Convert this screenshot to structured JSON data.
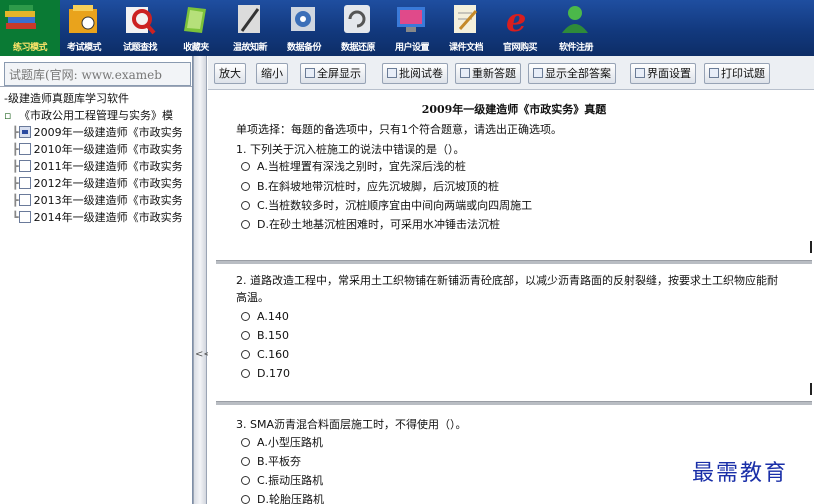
{
  "topbar": {
    "items": [
      {
        "label": "练习模式",
        "icon": "books-icon",
        "active": true
      },
      {
        "label": "考试模式",
        "icon": "exam-folder-icon"
      },
      {
        "label": "试题查找",
        "icon": "search-magnifier-icon"
      },
      {
        "label": "收藏夹",
        "icon": "favorites-icon"
      },
      {
        "label": "温故知新",
        "icon": "review-notes-icon"
      },
      {
        "label": "数据备份",
        "icon": "backup-disk-icon"
      },
      {
        "label": "数据还原",
        "icon": "restore-icon"
      },
      {
        "label": "用户设置",
        "icon": "user-settings-icon"
      },
      {
        "label": "课件文档",
        "icon": "document-icon"
      },
      {
        "label": "官网购买",
        "icon": "browser-icon"
      },
      {
        "label": "软件注册",
        "icon": "register-user-icon"
      }
    ]
  },
  "left": {
    "search_text": "试题库(官网: www.exameb",
    "tree": [
      {
        "label": "-级建造师真题库学习软件",
        "level": 0
      },
      {
        "label": "《市政公用工程管理与实务》模",
        "level": 1
      },
      {
        "label": "2009年一级建造师《市政实务",
        "level": 2,
        "selected": true
      },
      {
        "label": "2010年一级建造师《市政实务",
        "level": 2
      },
      {
        "label": "2011年一级建造师《市政实务",
        "level": 2
      },
      {
        "label": "2012年一级建造师《市政实务",
        "level": 2
      },
      {
        "label": "2013年一级建造师《市政实务",
        "level": 2
      },
      {
        "label": "2014年一级建造师《市政实务",
        "level": 2
      }
    ]
  },
  "splitter": {
    "grip": "<<"
  },
  "toolbar": {
    "buttons": [
      {
        "label": "放大"
      },
      {
        "label": "缩小"
      },
      {
        "label": "全屏显示"
      },
      {
        "label": "批阅试卷"
      },
      {
        "label": "重新答题"
      },
      {
        "label": "显示全部答案"
      },
      {
        "label": "界面设置"
      },
      {
        "label": "打印试题"
      }
    ]
  },
  "exam": {
    "title": "2009年一级建造师《市政实务》真题",
    "instruction": "单项选择：每题的备选项中，只有1个符合题意，请选出正确选项。",
    "questions": [
      {
        "stem": "1. 下列关于沉入桩施工的说法中错误的是（）。",
        "options": [
          "A.当桩埋置有深浅之别时，宜先深后浅的桩",
          "B.在斜坡地带沉桩时，应先沉坡脚，后沉坡顶的桩",
          "C.当桩数较多时，沉桩顺序宜由中间向两端或向四周施工",
          "D.在砂土地基沉桩困难时，可采用水冲锤击法沉桩"
        ]
      },
      {
        "stem": "2. 道路改造工程中，常采用土工织物铺在新铺沥青砼底部，以减少沥青路面的反射裂缝，按要求土工织物应能耐",
        "stem_cont": "高温。",
        "options": [
          "A.140",
          "B.150",
          "C.160",
          "D.170"
        ]
      },
      {
        "stem": "3. SMA沥青混合料面层施工时，不得使用（）。",
        "options": [
          "A.小型压路机",
          "B.平板夯",
          "C.振动压路机",
          "D.轮胎压路机"
        ]
      }
    ]
  },
  "watermark": "最需教育"
}
